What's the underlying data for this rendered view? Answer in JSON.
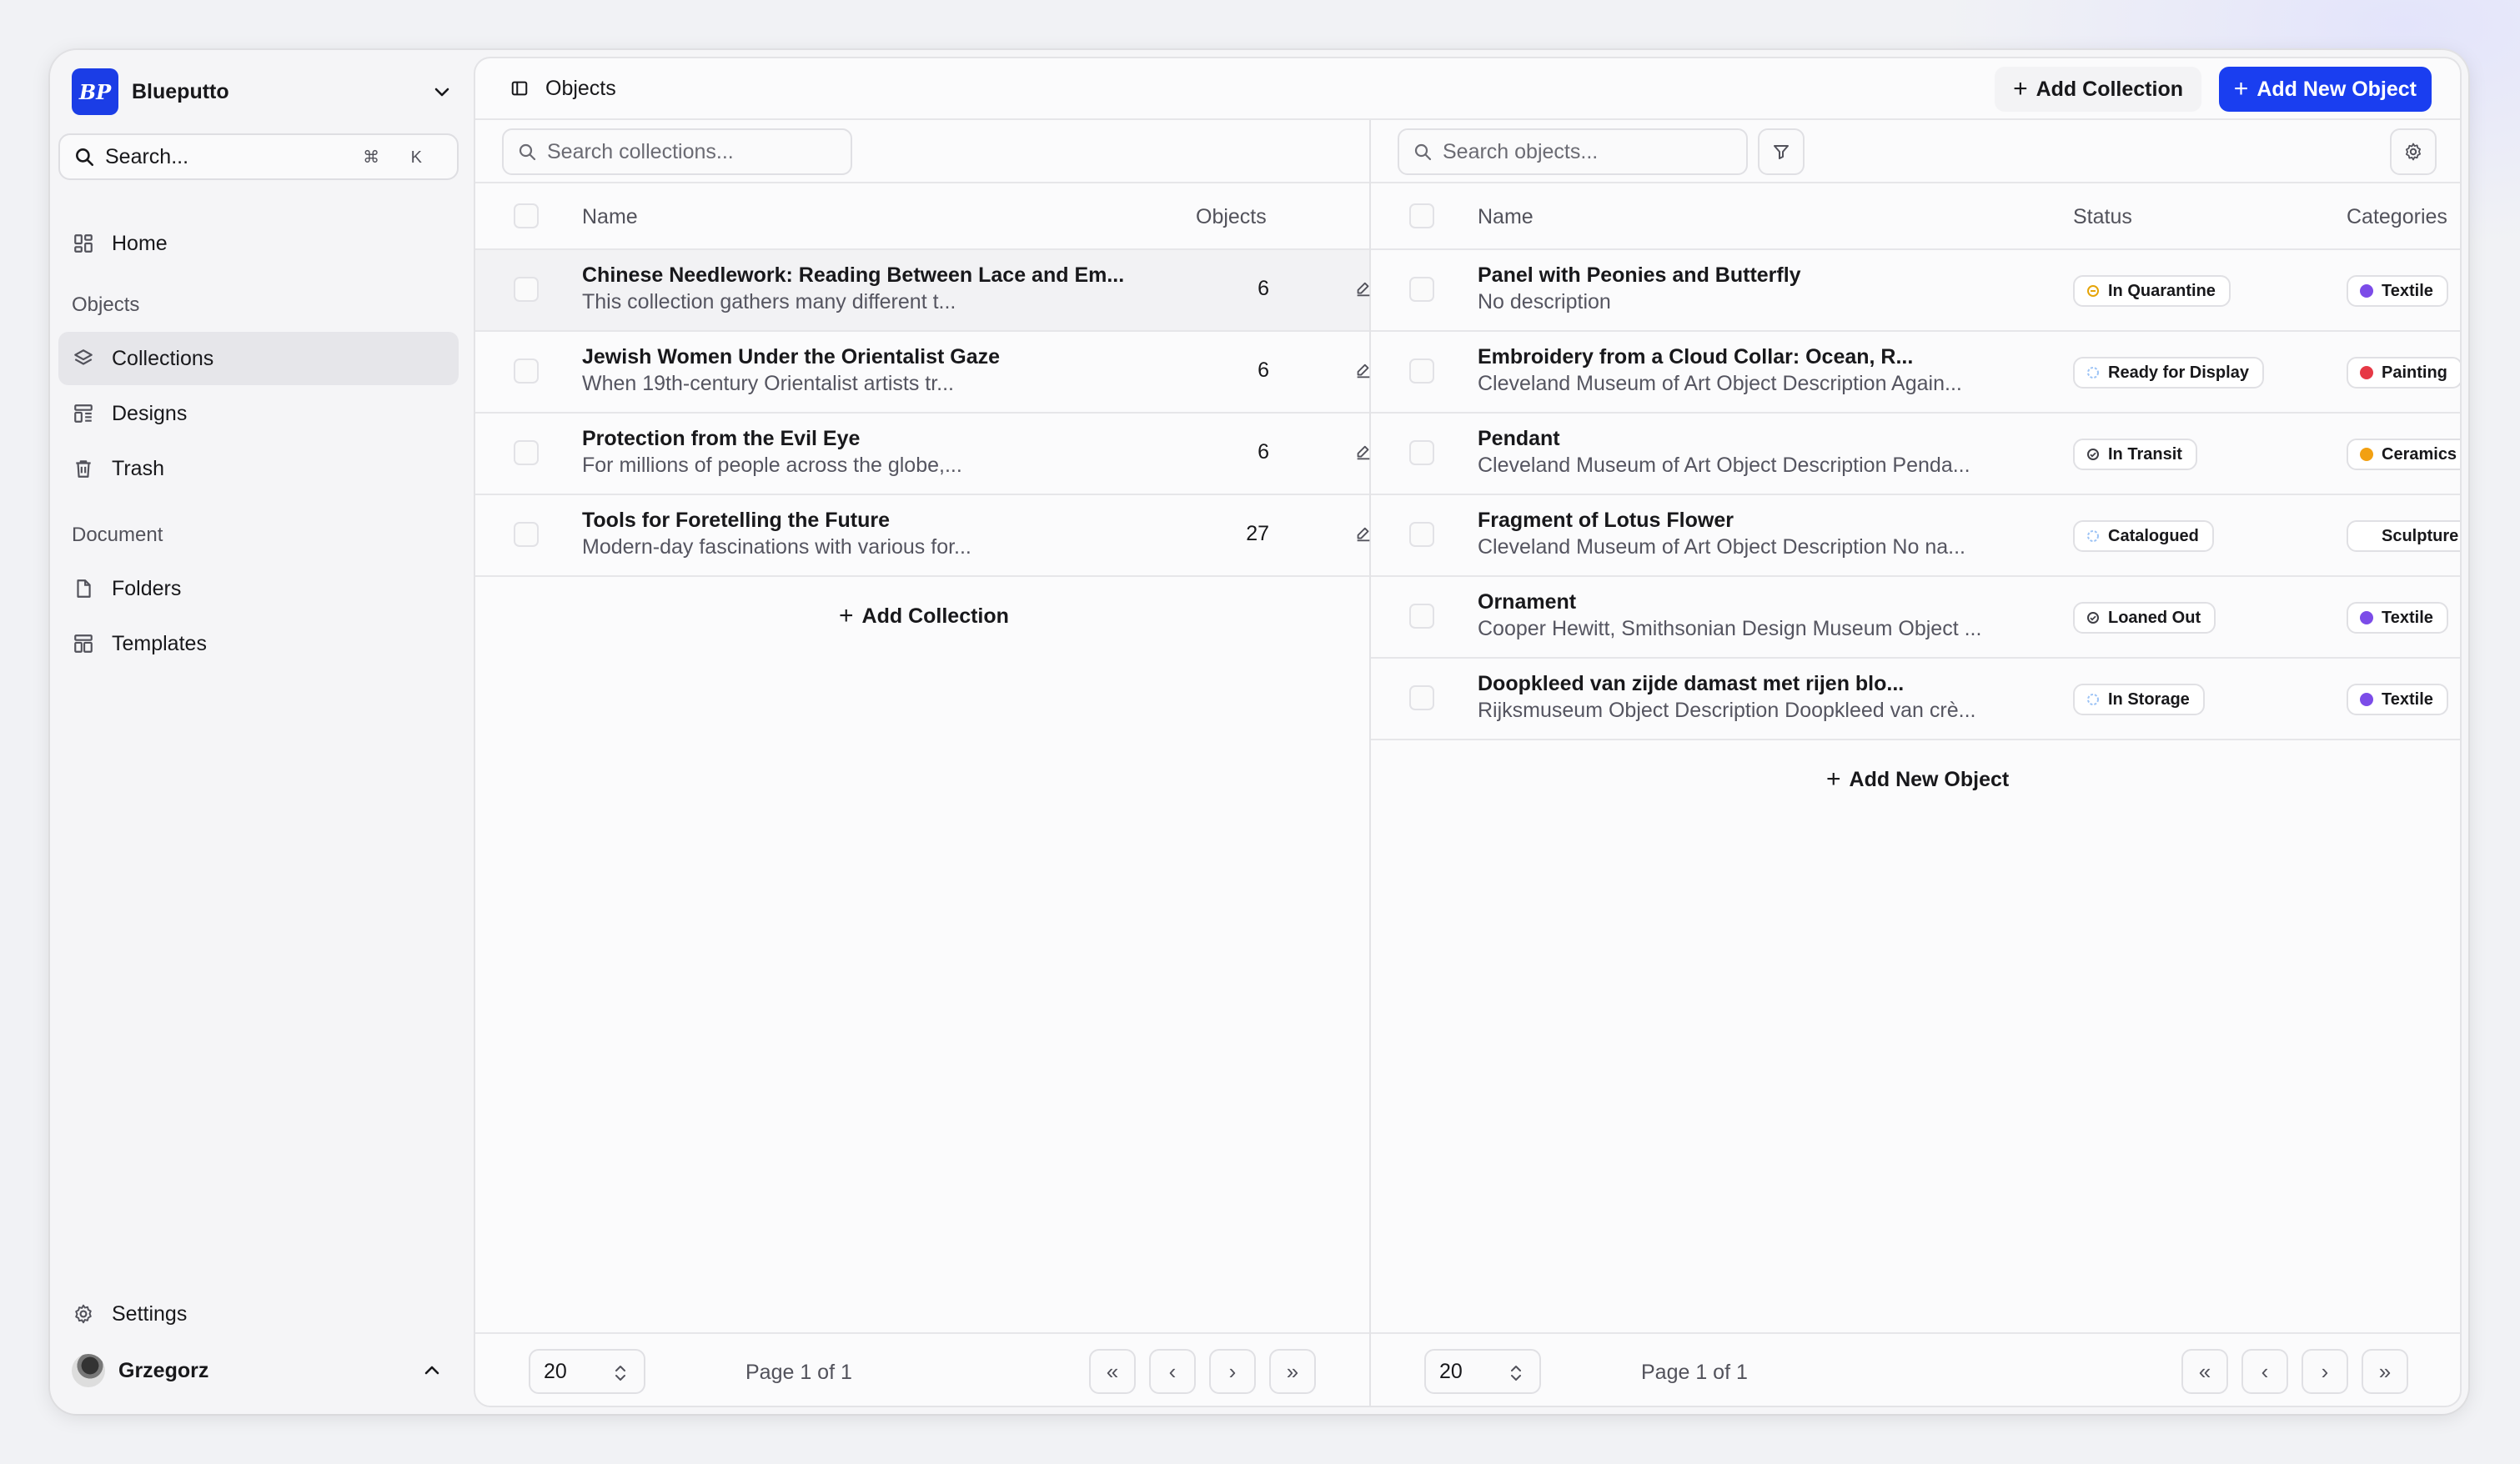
{
  "brand": {
    "name": "Blueputto",
    "logo_text": "BP"
  },
  "search": {
    "label": "Search...",
    "shortcut": "⌘ K"
  },
  "sidebar": {
    "home": "Home",
    "objects_section": "Objects",
    "objects_items": [
      {
        "label": "Collections"
      },
      {
        "label": "Designs"
      },
      {
        "label": "Trash"
      }
    ],
    "document_section": "Document",
    "document_items": [
      {
        "label": "Folders"
      },
      {
        "label": "Templates"
      }
    ],
    "settings": "Settings",
    "user": "Grzegorz"
  },
  "header": {
    "title": "Objects",
    "add_collection": "Add Collection",
    "add_object": "Add New Object"
  },
  "collections": {
    "search_placeholder": "Search collections...",
    "columns": {
      "name": "Name",
      "objects": "Objects"
    },
    "rows": [
      {
        "name": "Chinese Needlework: Reading Between Lace and Em...",
        "desc": "This collection gathers many different t...",
        "count": "6"
      },
      {
        "name": "Jewish Women Under the Orientalist Gaze",
        "desc": "When 19th-century Orientalist artists tr...",
        "count": "6"
      },
      {
        "name": "Protection from the Evil Eye",
        "desc": "For millions of people across the globe,...",
        "count": "6"
      },
      {
        "name": "Tools for Foretelling the Future",
        "desc": "Modern-day fascinations with various for...",
        "count": "27"
      }
    ],
    "add_label": "Add Collection",
    "page_size": "20",
    "page_info": "Page 1 of 1"
  },
  "objects": {
    "search_placeholder": "Search objects...",
    "columns": {
      "name": "Name",
      "status": "Status",
      "categories": "Categories"
    },
    "rows": [
      {
        "name": "Panel with Peonies and Butterfly",
        "desc": "No description",
        "status": "In Quarantine",
        "status_color": "#e5a50a",
        "category": "Textile",
        "category_color": "#7c4ce8"
      },
      {
        "name": "Embroidery from a Cloud Collar: Ocean, R...",
        "desc": "Cleveland Museum of Art Object Description Again...",
        "status": "Ready for Display",
        "status_color": "#9cc3f5",
        "category": "Painting",
        "category_color": "#e63946"
      },
      {
        "name": "Pendant",
        "desc": "Cleveland Museum of Art Object Description Penda...",
        "status": "In Transit",
        "status_color": "#3f3f46",
        "category": "Ceramics",
        "category_color": "#f2a012"
      },
      {
        "name": "Fragment of Lotus Flower",
        "desc": "Cleveland Museum of Art Object Description No na...",
        "status": "Catalogued",
        "status_color": "#9cc3f5",
        "category": "Sculpture",
        "category_color": "#ffffff"
      },
      {
        "name": "Ornament",
        "desc": "Cooper Hewitt, Smithsonian Design Museum Object ...",
        "status": "Loaned Out",
        "status_color": "#3f3f46",
        "category": "Textile",
        "category_color": "#7c4ce8"
      },
      {
        "name": "Doopkleed van zijde damast met rijen blo...",
        "desc": "Rijksmuseum Object Description Doopkleed van crè...",
        "status": "In Storage",
        "status_color": "#9cc3f5",
        "category": "Textile",
        "category_color": "#7c4ce8"
      }
    ],
    "add_label": "Add New Object",
    "page_size": "20",
    "page_info": "Page 1 of 1"
  },
  "colors": {
    "accent": "#1a3ef0",
    "active_nav": "#e6e6ea"
  }
}
